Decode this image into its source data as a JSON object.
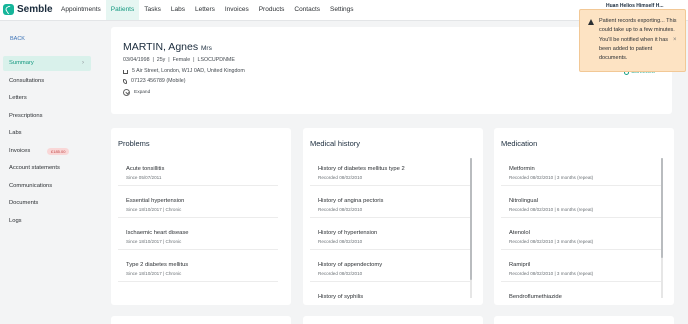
{
  "app": {
    "name": "Semble"
  },
  "nav": [
    {
      "label": "Appointments",
      "active": false
    },
    {
      "label": "Patients",
      "active": true
    },
    {
      "label": "Tasks",
      "active": false
    },
    {
      "label": "Labs",
      "active": false
    },
    {
      "label": "Letters",
      "active": false
    },
    {
      "label": "Invoices",
      "active": false
    },
    {
      "label": "Products",
      "active": false
    },
    {
      "label": "Contacts",
      "active": false
    },
    {
      "label": "Settings",
      "active": false
    }
  ],
  "user": {
    "name": "Huan Helios Himself H..."
  },
  "sidebar": {
    "back_label": "BACK",
    "items": [
      {
        "label": "Summary",
        "active": true
      },
      {
        "label": "Consultations"
      },
      {
        "label": "Letters"
      },
      {
        "label": "Prescriptions"
      },
      {
        "label": "Labs"
      },
      {
        "label": "Invoices",
        "badge": "£185.00"
      },
      {
        "label": "Account statements"
      },
      {
        "label": "Communications"
      },
      {
        "label": "Documents"
      },
      {
        "label": "Logs"
      }
    ]
  },
  "patient": {
    "name": "MARTIN, Agnes",
    "title": "Mrs",
    "meta": "03/04/1998  |  25y  |  Female  |  LSOCUPDNME",
    "address": "5 Air Street, London, W1J 0AD, United Kingdom",
    "phone": "07123 456789 (Mobile)",
    "expand_label": "Expand",
    "comment_label": "Comment"
  },
  "toast": {
    "message": "Patient records exporting... This could take up to a few minutes. You'll be notified when it has been added to patient documents.",
    "close": "×"
  },
  "panels": {
    "problems": {
      "title": "Problems",
      "items": [
        {
          "title": "Acute tonsillitis",
          "sub": "Since 05/07/2011"
        },
        {
          "title": "Essential hypertension",
          "sub": "Since 18/10/2017 | Chronic"
        },
        {
          "title": "Ischaemic heart disease",
          "sub": "Since 18/10/2017 | Chronic"
        },
        {
          "title": "Type 2 diabetes mellitus",
          "sub": "Since 18/10/2017 | Chronic"
        }
      ]
    },
    "medical_history": {
      "title": "Medical history",
      "items": [
        {
          "title": "History of diabetes mellitus type 2",
          "sub": "Recorded 08/02/2010"
        },
        {
          "title": "History of angina pectoris",
          "sub": "Recorded 08/02/2010"
        },
        {
          "title": "History of hypertension",
          "sub": "Recorded 08/02/2010"
        },
        {
          "title": "History of appendectomy",
          "sub": "Recorded 08/02/2010"
        },
        {
          "title": "History of syphilis",
          "sub": ""
        }
      ]
    },
    "medication": {
      "title": "Medication",
      "items": [
        {
          "title": "Metformin",
          "sub": "Recorded 08/02/2010 | 3 months (repeat)"
        },
        {
          "title": "Nitrolingual",
          "sub": "Recorded 08/02/2010 | 6 months (repeat)"
        },
        {
          "title": "Atenolol",
          "sub": "Recorded 08/02/2010 | 3 months (repeat)"
        },
        {
          "title": "Ramipril",
          "sub": "Recorded 08/02/2010 | 3 months (repeat)"
        },
        {
          "title": "Bendroflumethiazide",
          "sub": ""
        }
      ]
    }
  },
  "colors": {
    "accent": "#16b59a",
    "badge_bg": "#f9d7d7",
    "toast_bg": "#fde3c3"
  }
}
